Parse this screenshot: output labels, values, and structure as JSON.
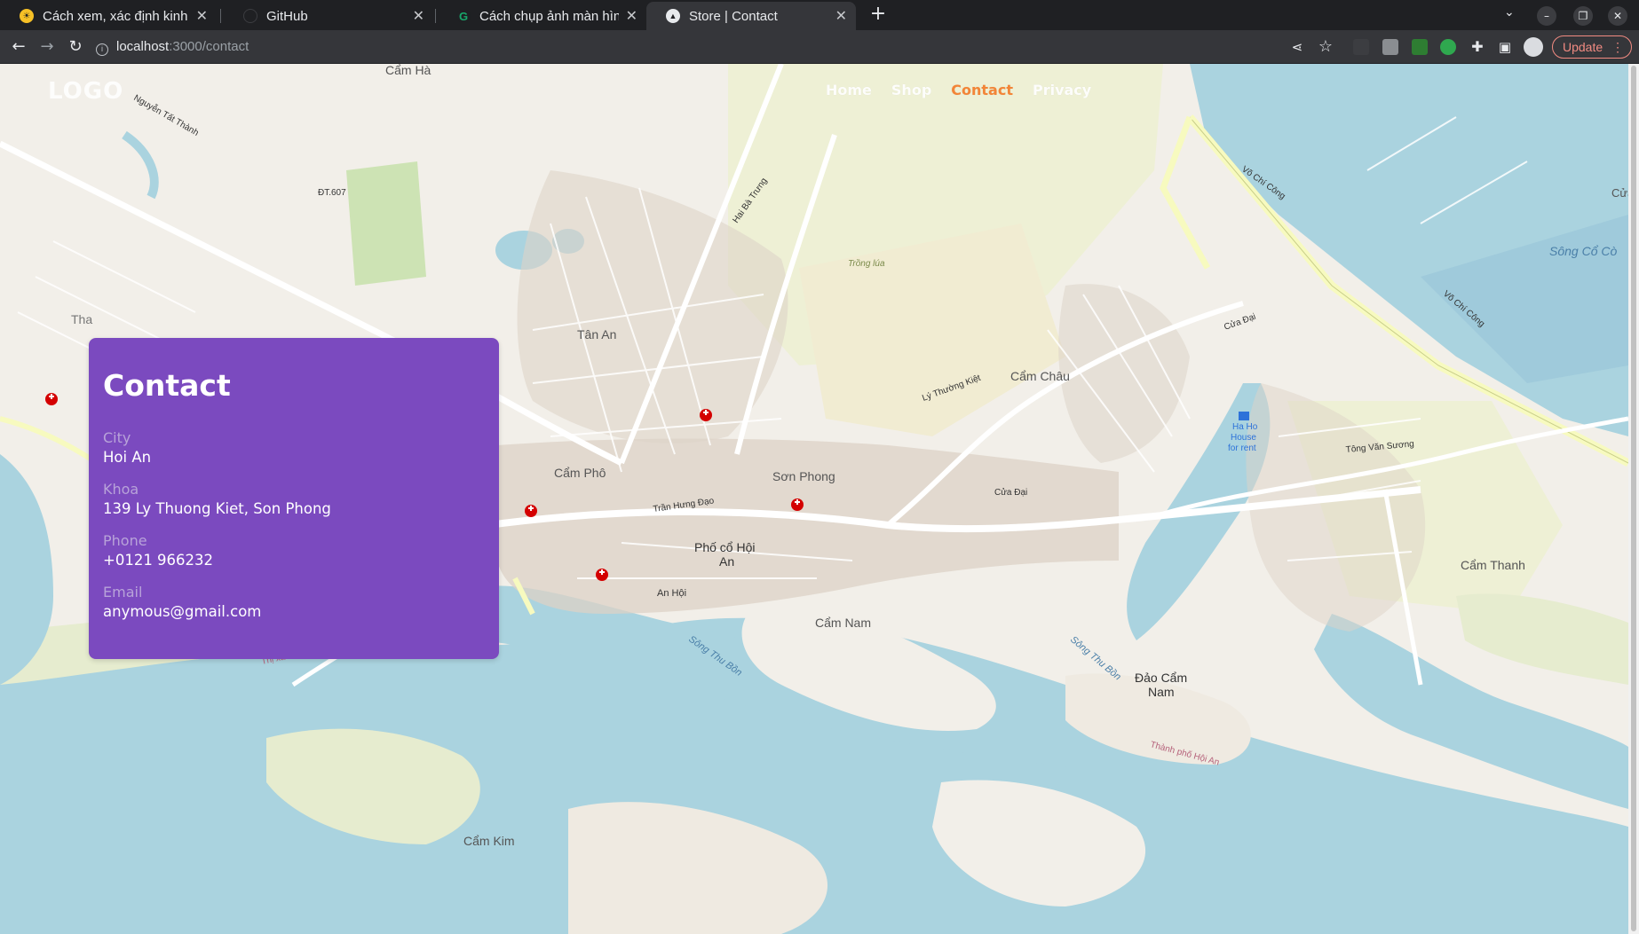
{
  "browser": {
    "tabs": [
      {
        "title": "Cách xem, xác định kinh ∂",
        "favicon": "sun-favicon-icon",
        "active": false
      },
      {
        "title": "GitHub",
        "favicon": "github-favicon-icon",
        "active": false
      },
      {
        "title": "Cách chụp ảnh màn hình",
        "favicon": "gc-favicon-icon",
        "active": false
      },
      {
        "title": "Store | Contact",
        "favicon": "store-favicon-icon",
        "active": true
      }
    ],
    "url_host": "localhost",
    "url_path": ":3000/contact",
    "update_label": "Update"
  },
  "site": {
    "logo": "LOGO",
    "nav": [
      {
        "label": "Home",
        "active": false
      },
      {
        "label": "Shop",
        "active": false
      },
      {
        "label": "Contact",
        "active": true
      },
      {
        "label": "Privacy",
        "active": false
      }
    ],
    "accent_color": "#f47c2a"
  },
  "contact": {
    "title": "Contact",
    "card_color": "#7b4abf",
    "fields": [
      {
        "label": "City",
        "value": "Hoi An"
      },
      {
        "label": "Khoa",
        "value": "139 Ly Thuong Kiet, Son Phong"
      },
      {
        "label": "Phone",
        "value": "+0121 966232"
      },
      {
        "label": "Email",
        "value": "anymous@gmail.com"
      }
    ]
  },
  "map": {
    "labels": {
      "cam_ha": "Cẩm Hà",
      "dt607": "ĐT.607",
      "tan_an": "Tân An",
      "cam_chau": "Cẩm Châu",
      "cam_pho": "Cẩm Phô",
      "son_phong": "Sơn Phong",
      "pho_co": "Phố cổ Hội",
      "pho_co_2": "An",
      "an_hoi": "An Hội",
      "cam_nam": "Cẩm Nam",
      "dao_cam_nam": "Đảo Cẩm",
      "dao_cam_nam_2": "Nam",
      "cam_thanh": "Cẩm Thanh",
      "cam_kim": "Cẩm Kim",
      "song_co_co": "Sông Cổ Cò",
      "song_thu_bon": "Sông Thu Bồn",
      "song_thu_bon_2": "Sông Thu Bồn",
      "thi_xa": "Thị xã Điện Bàn",
      "thanh_pho": "Thành phố Hội An",
      "ha_ho": "Ha Ho",
      "ha_ho_2": "House",
      "ha_ho_3": "for rent",
      "trong_lua": "Trồng lúa",
      "vo_chi_cong": "Võ Chí Công",
      "vo_chi_cong_2": "Võ Chí Công",
      "ly_thuong_kiet": "Lý Thường Kiệt",
      "tran_hung_dao": "Trần Hưng Đạo",
      "tong_van_suong": "Tông Văn Sương",
      "cua_dai": "Cửa Đại",
      "cua_dai_2": "Cửa Đại",
      "nguyen_tat_thanh": "Nguyễn Tất Thành",
      "hai_ba_trung": "Hai Bà Trưng",
      "tha": "Tha",
      "cua": "Cửa"
    }
  }
}
